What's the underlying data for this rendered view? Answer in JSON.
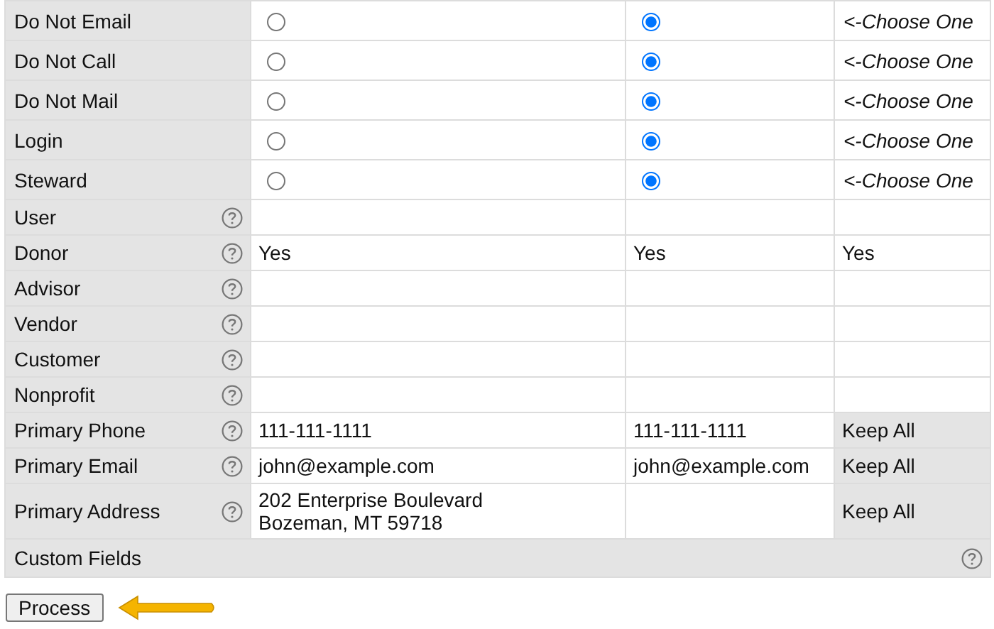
{
  "rows": [
    {
      "kind": "radio",
      "label": "Do Not Email",
      "help": false,
      "options": [
        {
          "selected": false
        },
        {
          "selected": true
        }
      ],
      "note": "<-Choose One"
    },
    {
      "kind": "radio",
      "label": "Do Not Call",
      "help": false,
      "options": [
        {
          "selected": false
        },
        {
          "selected": true
        }
      ],
      "note": "<-Choose One"
    },
    {
      "kind": "radio",
      "label": "Do Not Mail",
      "help": false,
      "options": [
        {
          "selected": false
        },
        {
          "selected": true
        }
      ],
      "note": "<-Choose One"
    },
    {
      "kind": "radio",
      "label": "Login",
      "help": false,
      "options": [
        {
          "selected": false
        },
        {
          "selected": true
        }
      ],
      "note": "<-Choose One"
    },
    {
      "kind": "radio",
      "label": "Steward",
      "help": false,
      "options": [
        {
          "selected": false
        },
        {
          "selected": true
        }
      ],
      "note": "<-Choose One"
    },
    {
      "kind": "field",
      "label": "User",
      "help": true
    },
    {
      "kind": "field",
      "label": "Donor",
      "help": true,
      "first": "Yes",
      "second": "Yes",
      "third": "Yes"
    },
    {
      "kind": "field",
      "label": "Advisor",
      "help": true
    },
    {
      "kind": "field",
      "label": "Vendor",
      "help": true
    },
    {
      "kind": "field",
      "label": "Customer",
      "help": true
    },
    {
      "kind": "field",
      "label": "Nonprofit",
      "help": true
    },
    {
      "kind": "field",
      "label": "Primary Phone",
      "help": true,
      "first": "111-111-1111",
      "second": "111-111-1111",
      "action": "Keep All"
    },
    {
      "kind": "field",
      "label": "Primary Email",
      "help": true,
      "first": "john@example.com",
      "second": "john@example.com",
      "action": "Keep All"
    },
    {
      "kind": "field",
      "label": "Primary Address",
      "help": true,
      "first": "202 Enterprise Boulevard\nBozeman, MT 59718",
      "action": "Keep All"
    },
    {
      "kind": "section",
      "label": "Custom Fields",
      "help": true
    }
  ],
  "button": "Process"
}
